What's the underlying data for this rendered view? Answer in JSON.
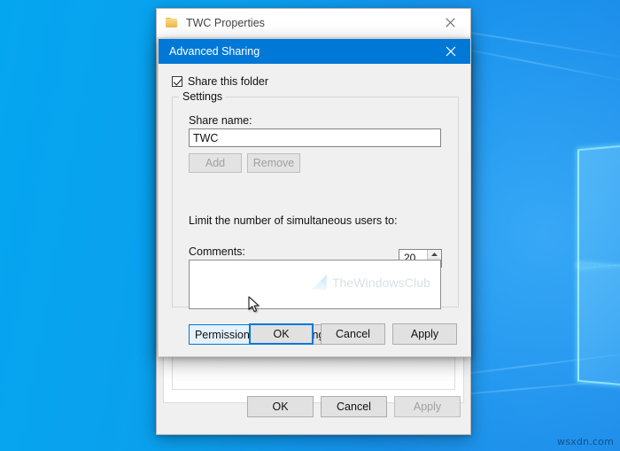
{
  "desktop": {
    "watermark": "wsxdn.com",
    "colors": {
      "wallpaper_blue": "#0aa0ef",
      "accent": "#0078d7"
    }
  },
  "properties_window": {
    "title": "TWC Properties",
    "icon": "folder-icon",
    "close_label": "✕",
    "buttons": [
      {
        "label": "OK",
        "state": "normal"
      },
      {
        "label": "Cancel",
        "state": "normal"
      },
      {
        "label": "Apply",
        "state": "disabled"
      }
    ]
  },
  "advanced_sharing": {
    "title": "Advanced Sharing",
    "close_label": "✕",
    "share_checkbox": {
      "label": "Share this folder",
      "checked": true
    },
    "settings_group": {
      "legend": "Settings",
      "share_name_label": "Share name:",
      "share_name_value": "TWC",
      "add_button": {
        "label": "Add",
        "state": "disabled"
      },
      "remove_button": {
        "label": "Remove",
        "state": "disabled"
      },
      "limit_label": "Limit the number of simultaneous users to:",
      "limit_value": "20",
      "comments_label": "Comments:",
      "comments_value": "",
      "comments_watermark": "TheWindowsClub"
    },
    "permissions_button": {
      "label": "Permissions",
      "state": "hover"
    },
    "caching_button": {
      "label": "Caching",
      "state": "normal"
    },
    "buttons": [
      {
        "label": "OK",
        "state": "default"
      },
      {
        "label": "Cancel",
        "state": "normal"
      },
      {
        "label": "Apply",
        "state": "normal"
      }
    ]
  }
}
